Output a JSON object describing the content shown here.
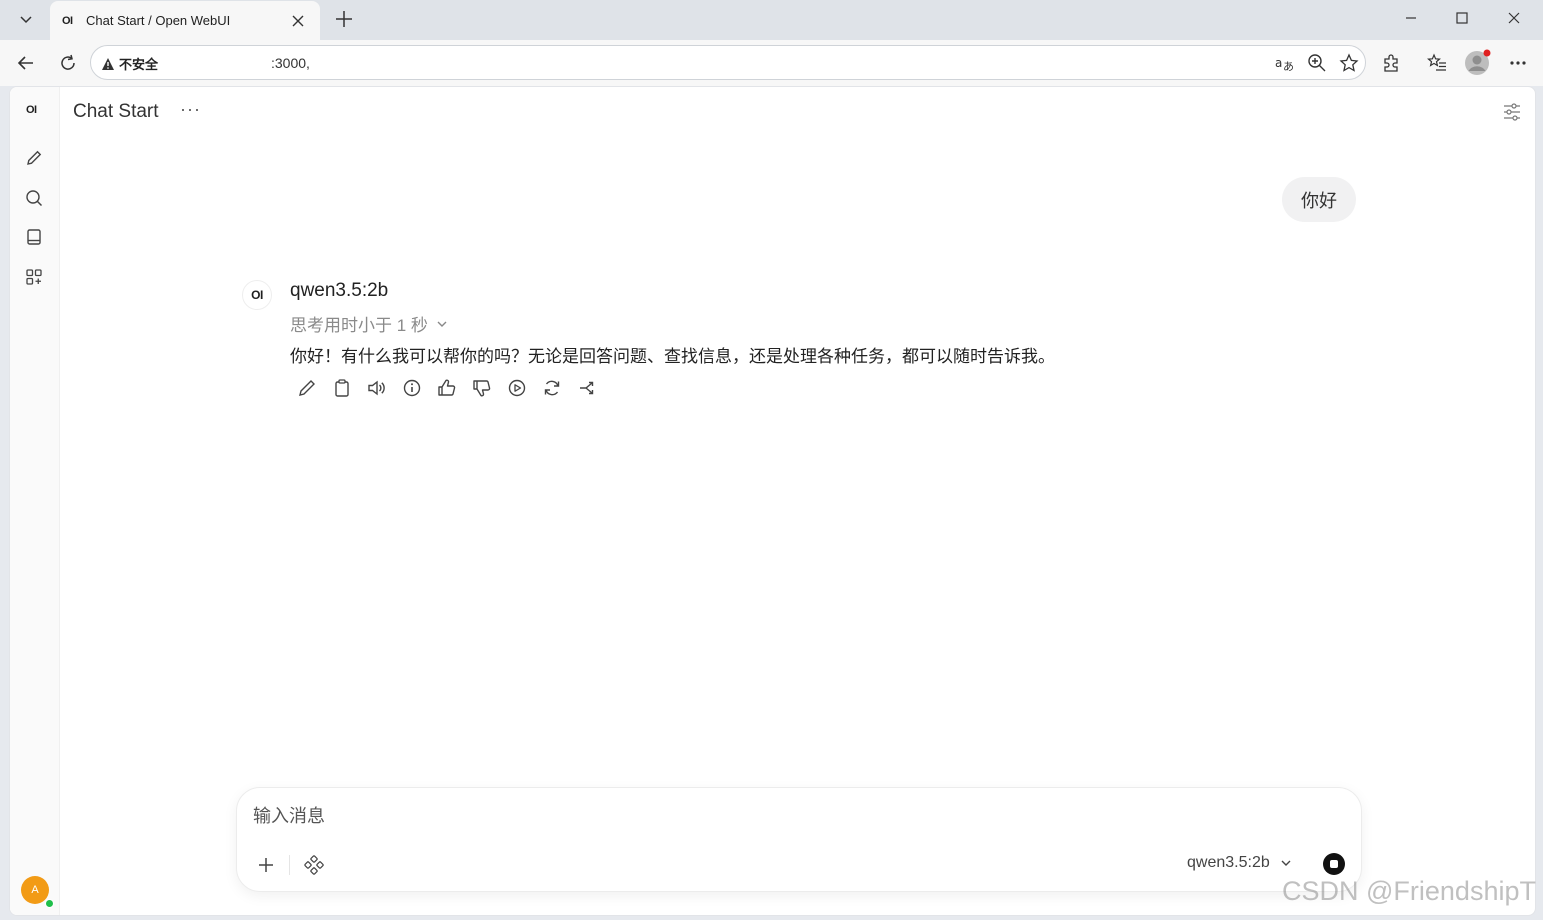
{
  "browser": {
    "tab": {
      "favicon": "OI",
      "title": "Chat Start / Open WebUI"
    },
    "address": {
      "security_label": "不安全",
      "url": ":3000,"
    }
  },
  "sidebar": {
    "logo": "OI",
    "user_initial": "A"
  },
  "header": {
    "title": "Chat Start",
    "more": "···"
  },
  "conversation": {
    "user_message": "你好",
    "assistant": {
      "avatar": "OI",
      "model": "qwen3.5:2b",
      "thinking": "思考用时小于 1 秒",
      "reply": "你好！有什么我可以帮你的吗？无论是回答问题、查找信息，还是处理各种任务，都可以随时告诉我。"
    }
  },
  "composer": {
    "placeholder": "输入消息",
    "model": "qwen3.5:2b"
  },
  "watermark": "CSDN @FriendshipT",
  "colors": {
    "avatar": "#f29b16",
    "online": "#1fbf4a"
  }
}
